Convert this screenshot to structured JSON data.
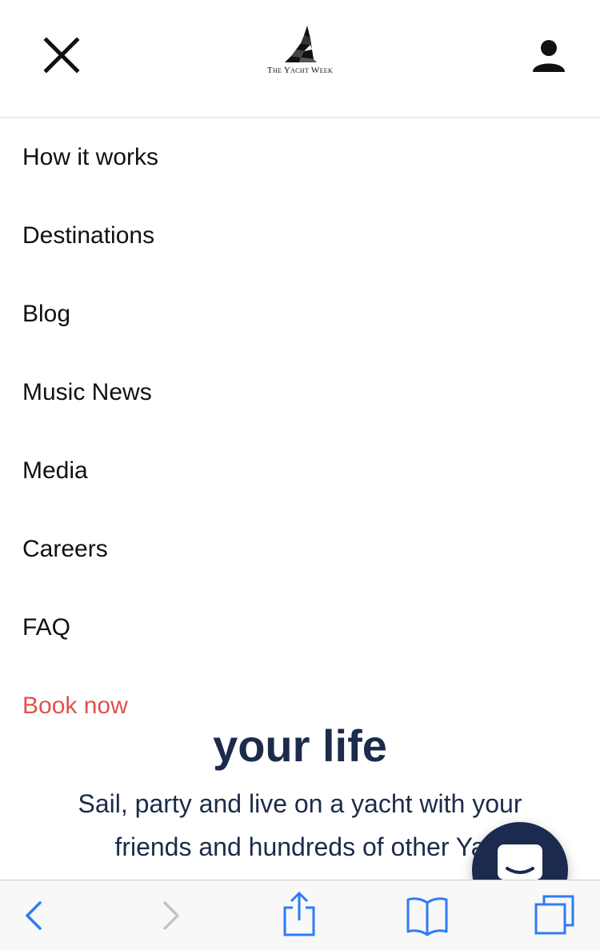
{
  "header": {
    "logo_text": "The Yacht Week",
    "close_icon": "close-icon",
    "user_icon": "user-icon"
  },
  "menu": {
    "items": [
      {
        "label": "How it works"
      },
      {
        "label": "Destinations"
      },
      {
        "label": "Blog"
      },
      {
        "label": "Music News"
      },
      {
        "label": "Media"
      },
      {
        "label": "Careers"
      },
      {
        "label": "FAQ"
      }
    ],
    "book_now": "Book now",
    "book_now_color": "#e0524a"
  },
  "background": {
    "hero_title": "your life",
    "hero_subtitle": "Sail, party and live on a yacht with your friends and hundreds of other Ya"
  },
  "chat": {
    "icon": "chat-icon",
    "color": "#1b2a4e"
  },
  "toolbar": {
    "icons": [
      "back-icon",
      "forward-icon",
      "share-icon",
      "bookmarks-icon",
      "tabs-icon"
    ],
    "accent": "#2f7bf6"
  }
}
